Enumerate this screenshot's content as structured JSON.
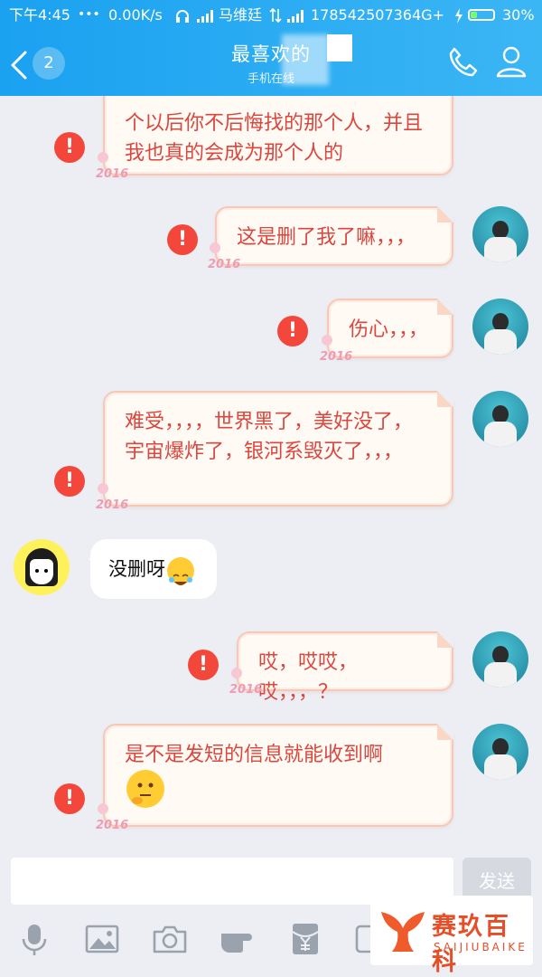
{
  "status_bar": {
    "time": "下午4:45",
    "dots": "•••",
    "speed": "0.00K/s",
    "carrier": "马维廷",
    "phone": "17854250736",
    "network": "4G+",
    "battery": "30%",
    "battery_level": 0.3
  },
  "header": {
    "unread_count": "2",
    "title": "最喜欢的",
    "subtitle": "手机在线"
  },
  "messages": [
    {
      "side": "right",
      "text": "个以后你不后悔找的那个人，并且我也真的会成为那个人的",
      "failed": true
    },
    {
      "side": "right",
      "text": "这是删了我了嘛，，，",
      "failed": true
    },
    {
      "side": "right",
      "text": "伤心，，，",
      "failed": true
    },
    {
      "side": "right",
      "text": "难受，，，，世界黑了，美好没了，宇宙爆炸了，银河系毁灭了，，，",
      "failed": true
    },
    {
      "side": "left",
      "text": "没删呀",
      "emoji": "laugh-cry-emoji"
    },
    {
      "side": "right",
      "text": "哎，哎哎，哎，，，？",
      "failed": true
    },
    {
      "side": "right",
      "text": "是不是发短的信息就能收到啊",
      "failed": true,
      "emoji": "thinking-emoji"
    }
  ],
  "bubble_deco": "2016",
  "error_mark": "!",
  "input": {
    "value": "",
    "send_label": "发送"
  },
  "toolbar": [
    "microphone-icon",
    "image-icon",
    "camera-icon",
    "hand-icon",
    "red-packet-icon",
    "gif-icon"
  ],
  "watermark": {
    "brand": "赛玖百科",
    "brand_en": "SAIJIUBAIKE"
  },
  "colors": {
    "header_blue": "#1aa1f0",
    "bubble_text": "#d9473f",
    "error_red": "#f4473b"
  }
}
